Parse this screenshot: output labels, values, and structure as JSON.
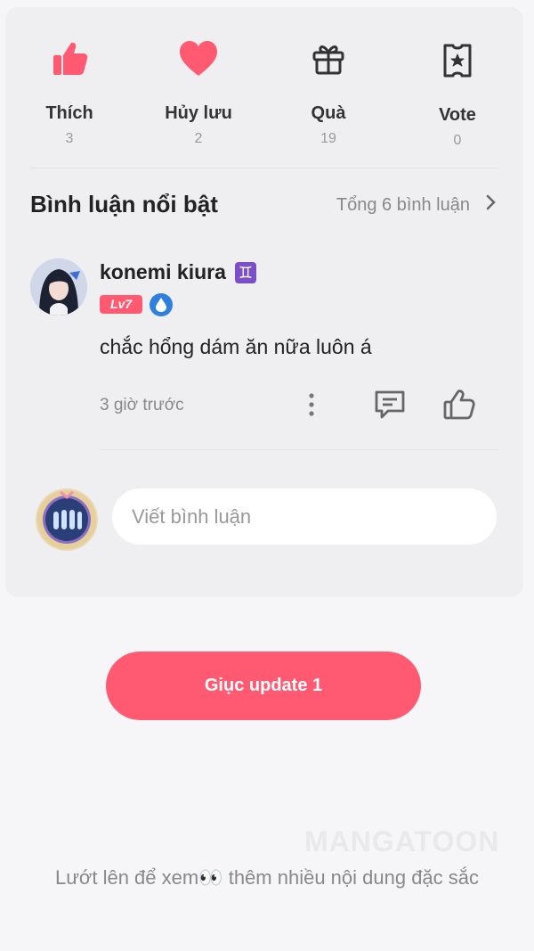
{
  "stats": [
    {
      "label": "Thích",
      "count": "3",
      "icon": "thumbs-up-filled-icon"
    },
    {
      "label": "Hủy lưu",
      "count": "2",
      "icon": "heart-filled-icon"
    },
    {
      "label": "Quà",
      "count": "19",
      "icon": "gift-icon"
    },
    {
      "label": "Vote",
      "count": "0",
      "icon": "vote-ticket-icon"
    }
  ],
  "comments_section": {
    "title": "Bình luận nổi bật",
    "total": "Tổng 6 bình luận"
  },
  "comment": {
    "username": "konemi kiura",
    "zodiac": "♊",
    "level": "Lv7",
    "text": "chắc hổng dám ăn nữa luôn á",
    "time": "3 giờ trước"
  },
  "comment_input": {
    "placeholder": "Viết bình luận"
  },
  "update_button": {
    "label": "Giục update 1"
  },
  "watermark": "MANGATOON",
  "footer": {
    "text": "Lướt lên để xem👀 thêm nhiều nội dung đặc sắc"
  },
  "colors": {
    "accent": "#ff5a72",
    "card_bg": "#efeff1",
    "page_bg": "#f6f6f8"
  }
}
